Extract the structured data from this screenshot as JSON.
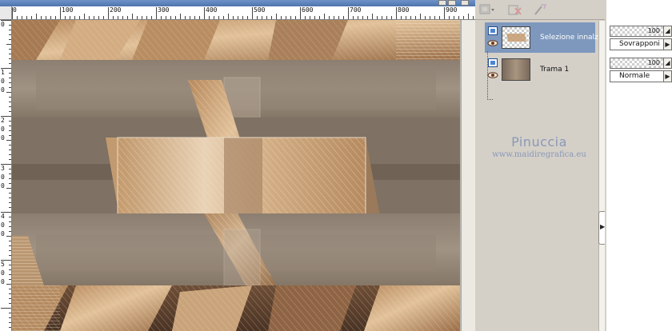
{
  "canvas": {
    "ruler_h_labels": [
      "0",
      "100",
      "200",
      "300",
      "400",
      "500",
      "600",
      "700",
      "800",
      "900"
    ],
    "ruler_v_labels": [
      [
        "0"
      ],
      [
        "1",
        "0",
        "0"
      ],
      [
        "2",
        "0",
        "0"
      ],
      [
        "3",
        "0",
        "0"
      ],
      [
        "4",
        "0",
        "0"
      ],
      [
        "5",
        "0",
        "0"
      ]
    ]
  },
  "layers_toolbar": {
    "icons": [
      "layer-visibility-menu-icon",
      "delete-layer-icon",
      "layer-properties-icon"
    ]
  },
  "layers": [
    {
      "name": "Selezione innalzata",
      "selected": true,
      "visible": true,
      "opacity": "100",
      "blend_mode": "Sovrapponi"
    },
    {
      "name": "Trama 1",
      "selected": false,
      "visible": true,
      "opacity": "100",
      "blend_mode": "Normale"
    }
  ],
  "watermark": {
    "title": "Pinuccia",
    "site": "www.maidiregrafica.eu"
  },
  "scrollbar": {
    "arrow": "▶"
  },
  "colors": {
    "selected_layer": "#7e98bd",
    "watermark": "#8a98b6",
    "panel": "#d4d0c8"
  }
}
